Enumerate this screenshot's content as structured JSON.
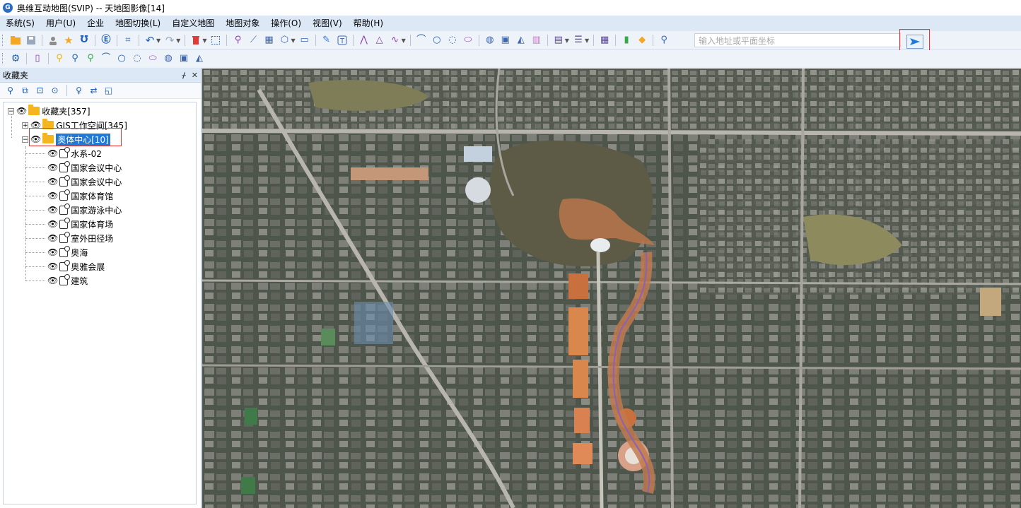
{
  "window": {
    "title": "奥维互动地图(SVIP) -- 天地图影像[14]"
  },
  "menu": [
    "系统(S)",
    "用户(U)",
    "企业",
    "地图切换(L)",
    "自定义地图",
    "地图对象",
    "操作(O)",
    "视图(V)",
    "帮助(H)"
  ],
  "search": {
    "placeholder": "输入地址或平面坐标"
  },
  "panel": {
    "title": "收藏夹",
    "pin_icon": "pin-icon",
    "close_icon": "close-icon",
    "tools": [
      "search-icon",
      "copy-icon",
      "import-icon",
      "locate-icon",
      "pin-icon",
      "swap-icon",
      "layer-icon"
    ]
  },
  "tree": {
    "root": "收藏夹[357]",
    "workspace": "GIS工作空间[345]",
    "selected_folder": "奥体中心[10]",
    "items": [
      "水系-02",
      "国家会议中心",
      "国家会议中心",
      "国家体育馆",
      "国家游泳中心",
      "国家体育场",
      "室外田径场",
      "奥海",
      "奥雅会展",
      "建筑"
    ]
  },
  "colors": {
    "accent": "#1e7ad6",
    "highlight_box": "#e3342f",
    "menubar": "#dde8f6"
  }
}
